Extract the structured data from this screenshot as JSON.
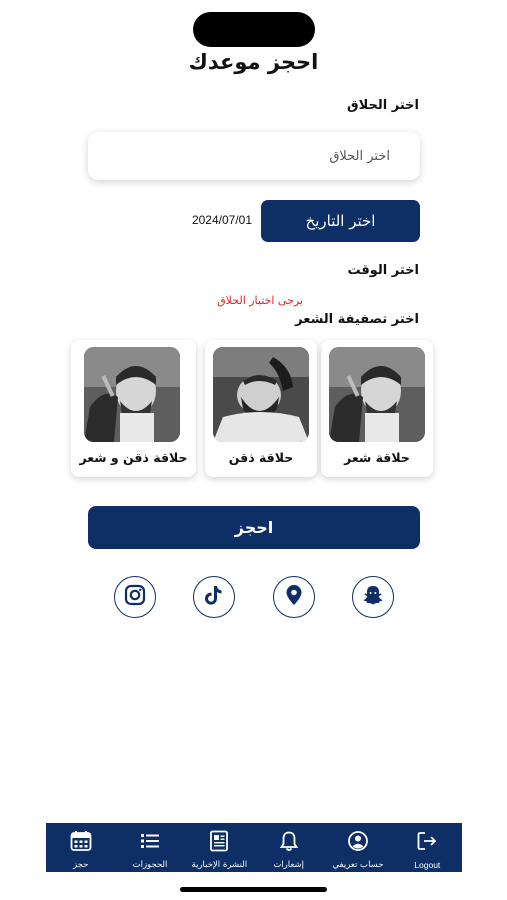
{
  "page": {
    "title": "احجز موعدك"
  },
  "barber": {
    "label": "اختر الحلاق",
    "placeholder": "اختر الحلاق"
  },
  "date": {
    "button_label": "اختر التاريخ",
    "value": "2024/07/01"
  },
  "time": {
    "label": "اختر الوقت",
    "error": "يرجى اختيار الحلاق"
  },
  "service": {
    "label": "اختر تصفيفة الشعر",
    "options": [
      {
        "label": "حلاقة شعر"
      },
      {
        "label": "حلاقة ذقن"
      },
      {
        "label": "حلاقة ذقن و شعر"
      }
    ]
  },
  "book": {
    "label": "احجز"
  },
  "social": [
    "snapchat-icon",
    "location-pin-icon",
    "tiktok-icon",
    "instagram-icon"
  ],
  "tabbar": {
    "items": [
      {
        "label": "Logout",
        "icon": "logout-icon"
      },
      {
        "label": "حساب تعريفي",
        "icon": "profile-icon"
      },
      {
        "label": "إشعارات",
        "icon": "bell-icon"
      },
      {
        "label": "النشرة الإخبارية",
        "icon": "newspaper-icon"
      },
      {
        "label": "الحجوزات",
        "icon": "list-icon"
      },
      {
        "label": "حجز",
        "icon": "calendar-icon"
      }
    ]
  },
  "colors": {
    "primary": "#0d2f66",
    "error": "#e02020"
  }
}
